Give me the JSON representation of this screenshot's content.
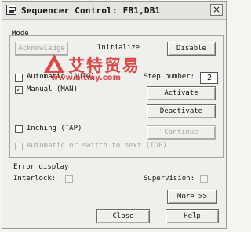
{
  "window": {
    "title": "Sequencer Control: FB1,DB1",
    "close_glyph": "×"
  },
  "mode": {
    "label": "Mode",
    "acknowledge_label": "Acknowledge",
    "initialize_label": "Initialize",
    "disable_label": "Disable",
    "automatic_label": "Automatic (AUTO)",
    "automatic_checked": false,
    "step_number_label": "Step number:",
    "step_number_value": "2",
    "manual_label": "Manual (MAN)",
    "manual_checked": true,
    "activate_label": "Activate",
    "deactivate_label": "Deactivate",
    "inching_label": "Inching (TAP)",
    "inching_checked": false,
    "continue_label": "Continue",
    "auto_or_switch_label": "Automatic or switch to next (TOP)",
    "auto_or_switch_checked": false
  },
  "error_display": {
    "label": "Error display",
    "interlock_label": "Interlock:",
    "interlock_checked": false,
    "supervision_label": "Supervision:",
    "supervision_checked": false
  },
  "buttons": {
    "more_label": "More >>",
    "close_label": "Close",
    "help_label": "Help"
  },
  "watermark": {
    "brand_text": "艾特贸易",
    "url_text": "www.aitmy.com"
  },
  "colors": {
    "watermark": "#d92b2b",
    "disabled_text": "#a6a6a2"
  }
}
